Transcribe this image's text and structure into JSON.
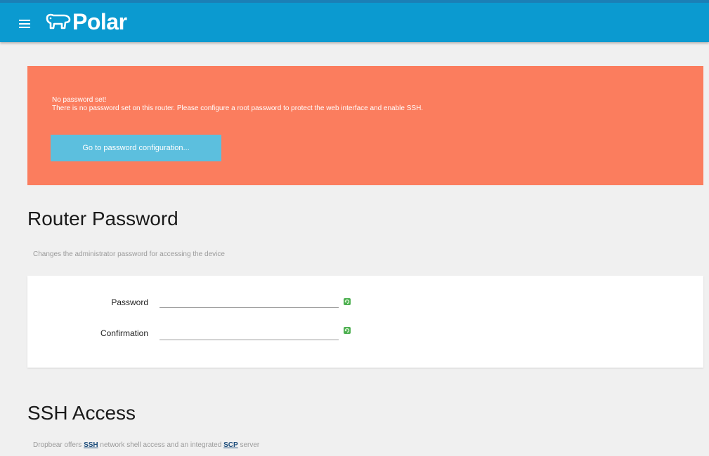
{
  "header": {
    "logo_text": "Polar",
    "color": "#0b9ad0"
  },
  "alert": {
    "title": "No password set!",
    "message": "There is no password set on this router. Please configure a root password to protect the web interface and enable SSH.",
    "button_label": "Go to password configuration...",
    "color": "#fb7d5e",
    "button_color": "#5cbfde"
  },
  "router_password": {
    "title": "Router Password",
    "description": "Changes the administrator password for accessing the device",
    "fields": [
      {
        "label": "Password",
        "value": ""
      },
      {
        "label": "Confirmation",
        "value": ""
      }
    ],
    "reveal_icon": "reload-icon"
  },
  "ssh_access": {
    "title": "SSH Access",
    "description_pre": "Dropbear offers",
    "link_ssh": "SSH",
    "description_mid": "network shell access and an integrated",
    "link_scp": "SCP",
    "description_post": "server"
  }
}
